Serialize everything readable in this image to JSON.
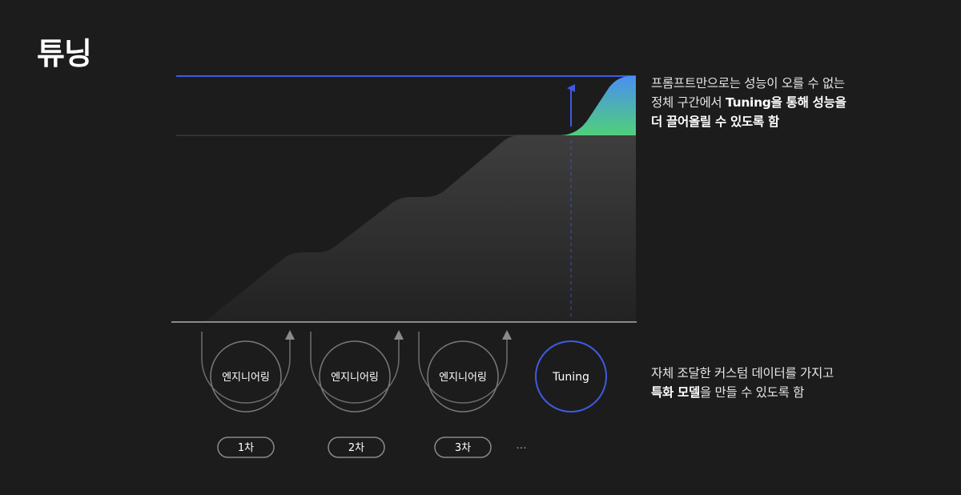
{
  "title": "튜닝",
  "cycles": [
    {
      "label": "엔지니어링",
      "step": "1차"
    },
    {
      "label": "엔지니어링",
      "step": "2차"
    },
    {
      "label": "엔지니어링",
      "step": "3차"
    }
  ],
  "ellipsis": "···",
  "tuning_label": "Tuning",
  "annotation_top": {
    "line1": "프롬프트만으로는 성능이 오를 수 없는",
    "line2_plain": "정체 구간에서 ",
    "line2_bold": "Tuning을 통해 성능을",
    "line3_bold": "더 끌어올릴 수 있도록 함"
  },
  "annotation_bottom": {
    "line1": "자체 조달한 커스텀 데이터를 가지고",
    "line2_bold": "특화 모델",
    "line2_plain": "을 만들 수 있도록 함"
  },
  "colors": {
    "background": "#1c1c1d",
    "accent_blue": "#3f5be0",
    "gradient_top": "#4a8fe8",
    "gradient_bottom": "#4ccf7e",
    "area_top": "#3d3d3e",
    "area_bottom": "#202021",
    "gray_line": "#6e6e70"
  }
}
